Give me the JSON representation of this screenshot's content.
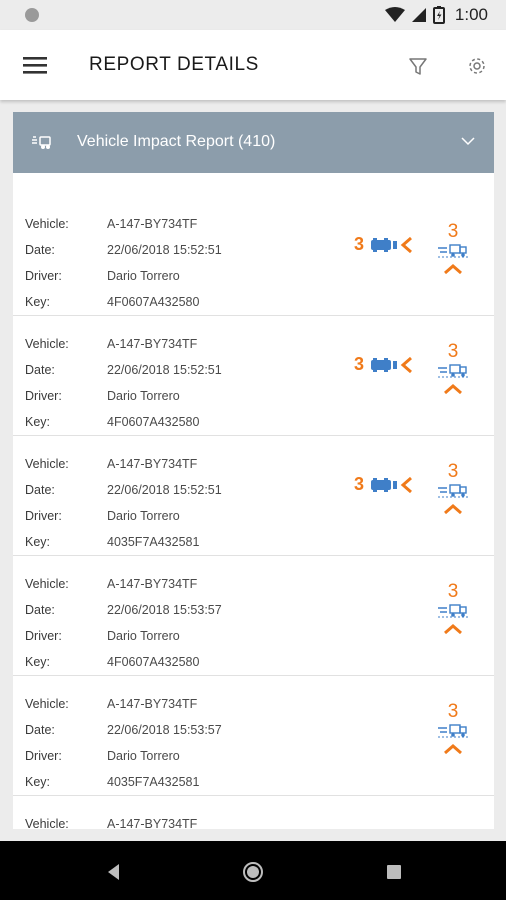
{
  "status_bar": {
    "time": "1:00"
  },
  "app_bar": {
    "title": "REPORT DETAILS"
  },
  "section": {
    "title": "Vehicle Impact Report (410)"
  },
  "labels": {
    "vehicle": "Vehicle:",
    "date": "Date:",
    "driver": "Driver:",
    "key": "Key:"
  },
  "reports": [
    {
      "vehicle": "A-147-BY734TF",
      "date": "22/06/2018 15:52:51",
      "driver": "Dario Torrero",
      "key": "4F0607A432580",
      "impact_count": "3",
      "event_count": "3"
    },
    {
      "vehicle": "A-147-BY734TF",
      "date": "22/06/2018 15:52:51",
      "driver": "Dario Torrero",
      "key": "4F0607A432580",
      "impact_count": "3",
      "event_count": "3"
    },
    {
      "vehicle": "A-147-BY734TF",
      "date": "22/06/2018 15:52:51",
      "driver": "Dario Torrero",
      "key": "4035F7A432581",
      "impact_count": "3",
      "event_count": "3"
    },
    {
      "vehicle": "A-147-BY734TF",
      "date": "22/06/2018 15:53:57",
      "driver": "Dario Torrero",
      "key": "4F0607A432580",
      "impact_count": "",
      "event_count": "3"
    },
    {
      "vehicle": "A-147-BY734TF",
      "date": "22/06/2018 15:53:57",
      "driver": "Dario Torrero",
      "key": "4035F7A432581",
      "impact_count": "",
      "event_count": "3"
    },
    {
      "vehicle": "A-147-BY734TF",
      "date": "",
      "driver": "",
      "key": "",
      "impact_count": "",
      "event_count": ""
    }
  ],
  "colors": {
    "accent_orange": "#f07a1a",
    "icon_blue": "#3f7fc8",
    "header_bg": "#8c9dab"
  },
  "icons": {
    "menu": "hamburger-icon",
    "filter": "filter-icon",
    "settings": "gear-icon",
    "section": "truck-impact-icon",
    "collapse": "chevron-down-icon",
    "impact": "rear-impact-icon",
    "event": "truck-event-icon",
    "expand": "chevron-up-icon"
  }
}
